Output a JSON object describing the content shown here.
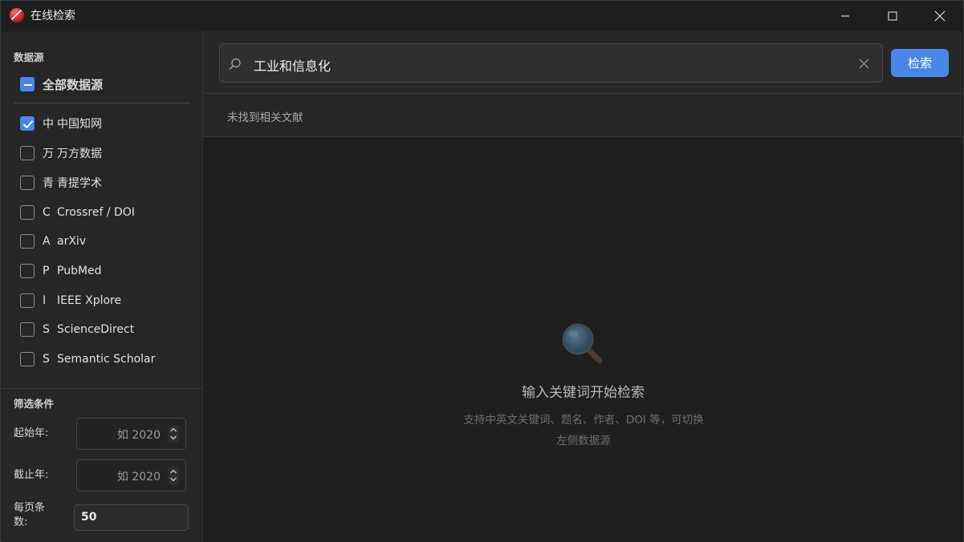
{
  "window": {
    "title": "在线检索"
  },
  "sidebar": {
    "sources_title": "数据源",
    "all_sources_label": "全部数据源",
    "sources": [
      {
        "prefix": "中",
        "name": "中国知网",
        "checked": true
      },
      {
        "prefix": "万",
        "name": "万方数据",
        "checked": false
      },
      {
        "prefix": "青",
        "name": "青提学术",
        "checked": false
      },
      {
        "prefix": "C",
        "name": "Crossref / DOI",
        "checked": false
      },
      {
        "prefix": "A",
        "name": "arXiv",
        "checked": false
      },
      {
        "prefix": "P",
        "name": "PubMed",
        "checked": false
      },
      {
        "prefix": "I",
        "name": "IEEE Xplore",
        "checked": false
      },
      {
        "prefix": "S",
        "name": "ScienceDirect",
        "checked": false
      },
      {
        "prefix": "S",
        "name": "Semantic Scholar",
        "checked": false
      }
    ],
    "filters_title": "筛选条件",
    "start_year_label": "起始年:",
    "start_year_placeholder": "如 2020",
    "end_year_label": "截止年:",
    "end_year_placeholder": "如 2020",
    "per_page_label_1": "每页条",
    "per_page_label_2": "数:",
    "per_page_value": "50"
  },
  "search": {
    "query": "工业和信息化",
    "button_label": "检索"
  },
  "status": {
    "message": "未找到相关文献"
  },
  "empty_state": {
    "title": "输入关键词开始检索",
    "subtitle_line1": "支持中英文关键词、题名、作者、DOI 等，可切换",
    "subtitle_line2": "左侧数据源"
  },
  "colors": {
    "accent": "#4a86e8",
    "background": "#202020",
    "sidebar": "#262626"
  }
}
